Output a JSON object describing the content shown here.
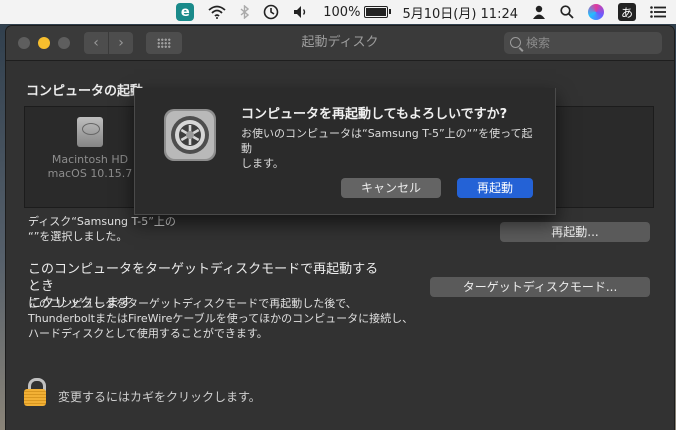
{
  "menubar": {
    "app_icon_letter": "e",
    "battery_percent": "100%",
    "datetime": "5月10日(月)  11:24",
    "input_method": "あ"
  },
  "window": {
    "title": "起動ディスク",
    "search_placeholder": "検索",
    "section_title": "コンピュータの起動",
    "disk": {
      "name": "Macintosh HD",
      "os": "macOS 10.15.7"
    },
    "selected_line1": "ディスク“Samsung T-5”上の",
    "selected_line2": "“”を選択しました。",
    "restart_button": "再起動...",
    "target_title_line1": "このコンピュータをターゲットディスクモードで再起動するとき",
    "target_title_line2": "にクリックします",
    "target_button": "ターゲットディスクモード...",
    "target_desc_line1": "このコンピュータをターゲットディスクモードで再起動した後で、",
    "target_desc_line2": "ThunderboltまたはFireWireケーブルを使ってほかのコンピュータに接続し、",
    "target_desc_line3": "ハードディスクとして使用することができます。",
    "lock_text": "変更するにはカギをクリックします。"
  },
  "dialog": {
    "title": "コンピュータを再起動してもよろしいですか?",
    "message_line1": "お使いのコンピュータは“Samsung T-5”上の“”を使って起動",
    "message_line2": "します。",
    "cancel_label": "キャンセル",
    "confirm_label": "再起動"
  }
}
